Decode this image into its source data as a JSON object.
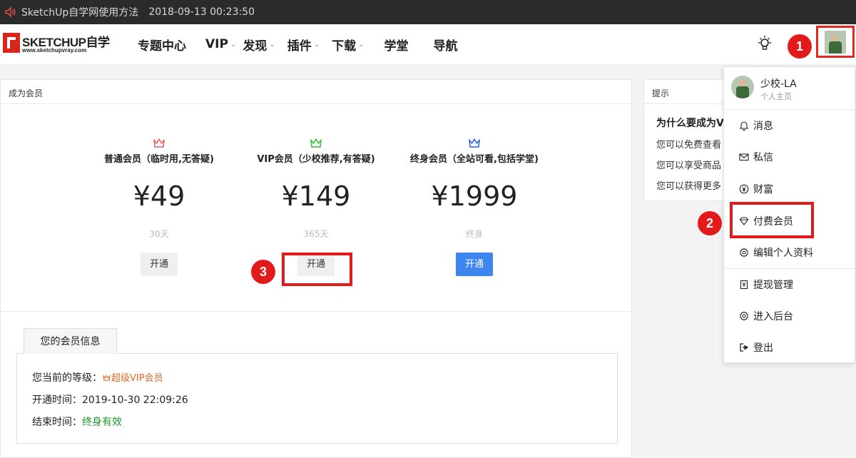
{
  "titlebar": {
    "title": "SketchUp自学网使用方法",
    "timestamp": "2018-09-13 00:23:50"
  },
  "header": {
    "logo_brand": "SKETCHUP自学",
    "logo_url": "www.sketchupvray.com",
    "nav": [
      {
        "label": "专题中心",
        "dropdown": false
      },
      {
        "label": "VIP",
        "dropdown": true
      },
      {
        "label": "发现",
        "dropdown": true
      },
      {
        "label": "插件",
        "dropdown": true
      },
      {
        "label": "下载",
        "dropdown": true
      },
      {
        "label": "学堂",
        "dropdown": false
      },
      {
        "label": "导航",
        "dropdown": false
      }
    ]
  },
  "annotations": {
    "badge1": "1",
    "badge2": "2",
    "badge3": "3",
    "highlight_color": "#e21a1a"
  },
  "membership": {
    "panel_title": "成为会员",
    "plans": [
      {
        "name": "普通会员（临时用,无答疑)",
        "price": "¥49",
        "period": "30天",
        "button": "开通",
        "crown_color": "#e35d5d",
        "button_style": "gray"
      },
      {
        "name": "VIP会员（少校推荐,有答疑)",
        "price": "¥149",
        "period": "365天",
        "button": "开通",
        "crown_color": "#2fbf3a",
        "button_style": "gray"
      },
      {
        "name": "终身会员（全站可看,包括学堂)",
        "price": "¥1999",
        "period": "终身",
        "button": "开通",
        "crown_color": "#2a5fe0",
        "button_style": "blue"
      }
    ],
    "info": {
      "tab_label": "您的会员信息",
      "level_label": "您当前的等级：",
      "level_value": "超级VIP会员",
      "start_label": "开通时间：",
      "start_value": "2019-10-30 22:09:26",
      "end_label": "结束时间：",
      "end_value": "终身有效"
    }
  },
  "tips": {
    "panel_title": "提示",
    "heading": "为什么要成为V",
    "lines": [
      "您可以免费查看",
      "您可以享受商品",
      "您可以获得更多"
    ]
  },
  "user_menu": {
    "name": "少校-LA",
    "subtitle": "个人主页",
    "items": [
      {
        "label": "消息",
        "icon": "bell-icon"
      },
      {
        "label": "私信",
        "icon": "mail-icon"
      },
      {
        "label": "财富",
        "icon": "yen-coin-icon"
      },
      {
        "label": "付费会员",
        "icon": "diamond-icon"
      },
      {
        "label": "编辑个人资料",
        "icon": "gear-icon"
      },
      {
        "label": "提现管理",
        "icon": "withdraw-icon"
      },
      {
        "label": "进入后台",
        "icon": "gear-icon"
      },
      {
        "label": "登出",
        "icon": "logout-icon"
      }
    ]
  }
}
